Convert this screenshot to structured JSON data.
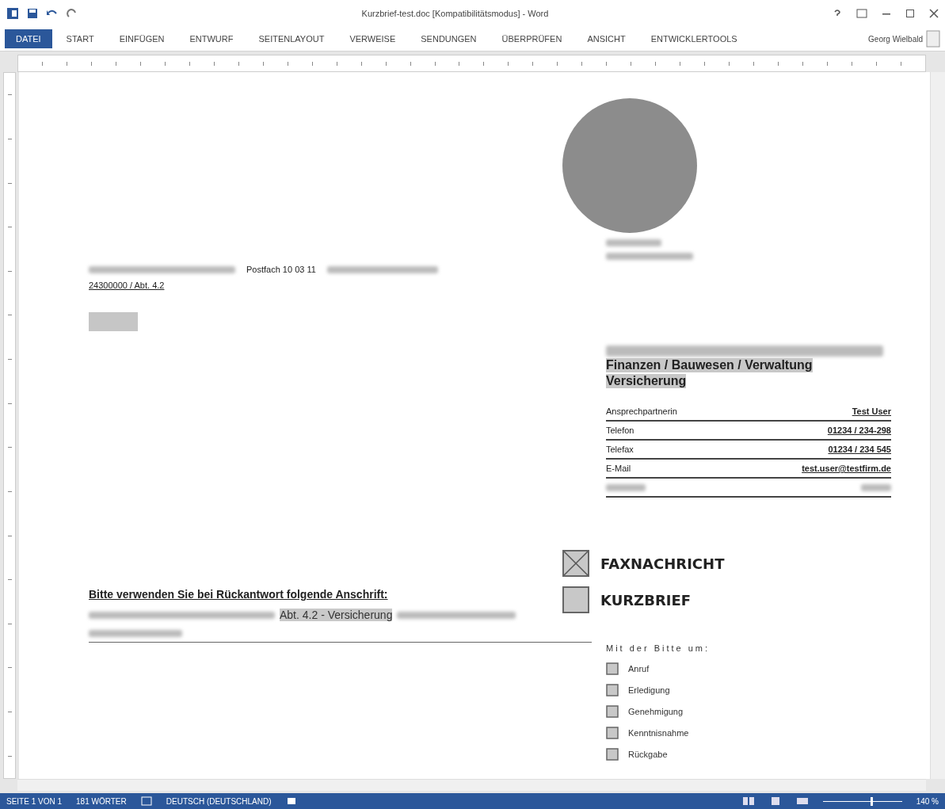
{
  "window": {
    "title": "Kurzbrief-test.doc [Kompatibilitätsmodus] - Word",
    "user": "Georg Wielbald"
  },
  "tabs": [
    {
      "label": "DATEI",
      "selected": true
    },
    {
      "label": "START",
      "selected": false
    },
    {
      "label": "EINFÜGEN",
      "selected": false
    },
    {
      "label": "ENTWURF",
      "selected": false
    },
    {
      "label": "SEITENLAYOUT",
      "selected": false
    },
    {
      "label": "VERWEISE",
      "selected": false
    },
    {
      "label": "SENDUNGEN",
      "selected": false
    },
    {
      "label": "ÜBERPRÜFEN",
      "selected": false
    },
    {
      "label": "ANSICHT",
      "selected": false
    },
    {
      "label": "ENTWICKLERTOOLS",
      "selected": false
    }
  ],
  "letter": {
    "sender_postbox": "Postfach 10 03 11",
    "reference": "24300000 / Abt. 4.2",
    "department": [
      "Finanzen / Bauwesen / Verwaltung",
      "Versicherung"
    ],
    "contacts": [
      {
        "label": "Ansprechpartnerin",
        "value": "Test User"
      },
      {
        "label": "Telefon",
        "value": "01234 / 234-298"
      },
      {
        "label": "Telefax",
        "value": "01234 / 234 545"
      },
      {
        "label": "E-Mail",
        "value": "test.user@testfirm.de"
      }
    ],
    "types": [
      {
        "label": "FAXNACHRICHT",
        "checked": true
      },
      {
        "label": "KURZBRIEF",
        "checked": false
      }
    ],
    "reply_heading": "Bitte verwenden Sie bei Rückantwort folgende Anschrift:",
    "reply_department": "Abt. 4.2 - Versicherung",
    "request_heading": "Mit der Bitte um:",
    "requests": [
      {
        "label": "Anruf",
        "checked": false
      },
      {
        "label": "Erledigung",
        "checked": false
      },
      {
        "label": "Genehmigung",
        "checked": false
      },
      {
        "label": "Kenntnisnahme",
        "checked": false
      },
      {
        "label": "Rückgabe",
        "checked": false
      }
    ]
  },
  "status_bar": {
    "page": "SEITE 1 VON 1",
    "words": "181 WÖRTER",
    "language": "DEUTSCH (DEUTSCHLAND)",
    "zoom": "140 %",
    "zoom_slider": {
      "level": 0.6
    }
  }
}
